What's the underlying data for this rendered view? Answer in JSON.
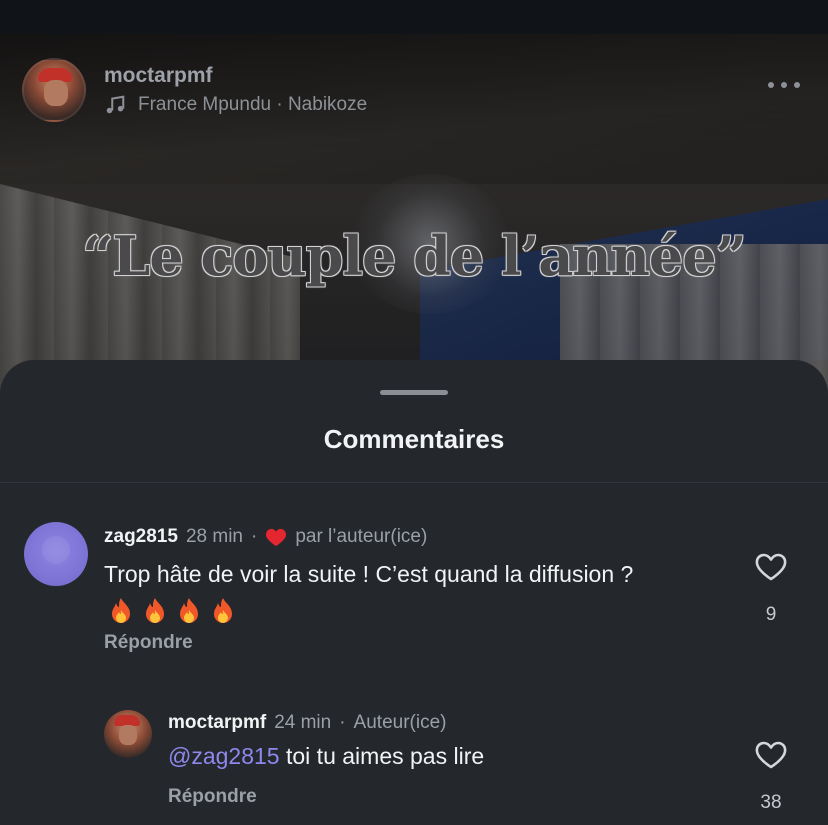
{
  "post": {
    "username": "moctarpmf",
    "music": "France Mpundu · Nabikoze",
    "caption": "“Le couple de l’année”"
  },
  "comments_sheet": {
    "title": "Commentaires",
    "comments": [
      {
        "username": "zag2815",
        "time": "28 min",
        "separator": "·",
        "badge": "par l’auteur(ice)",
        "text": "Trop hâte de voir la suite ! C’est quand la diffusion ?",
        "emoji_line": "🔥🔥🔥🔥",
        "reply_label": "Répondre",
        "likes": "9"
      },
      {
        "username": "moctarpmf",
        "time": "24 min",
        "separator": "·",
        "badge": "Auteur(ice)",
        "mention": "@zag2815",
        "text": "toi tu aimes pas lire",
        "reply_label": "Répondre",
        "likes": "38"
      }
    ]
  },
  "icons": {
    "music": "music-note-icon",
    "more": "more-horizontal-icon",
    "heart_filled": "heart-filled-icon",
    "heart_outline": "heart-outline-icon",
    "fire": "fire-icon"
  },
  "colors": {
    "sheet_bg": "#24272c",
    "mention": "#8e88ee",
    "liked_heart": "#e3262f"
  }
}
